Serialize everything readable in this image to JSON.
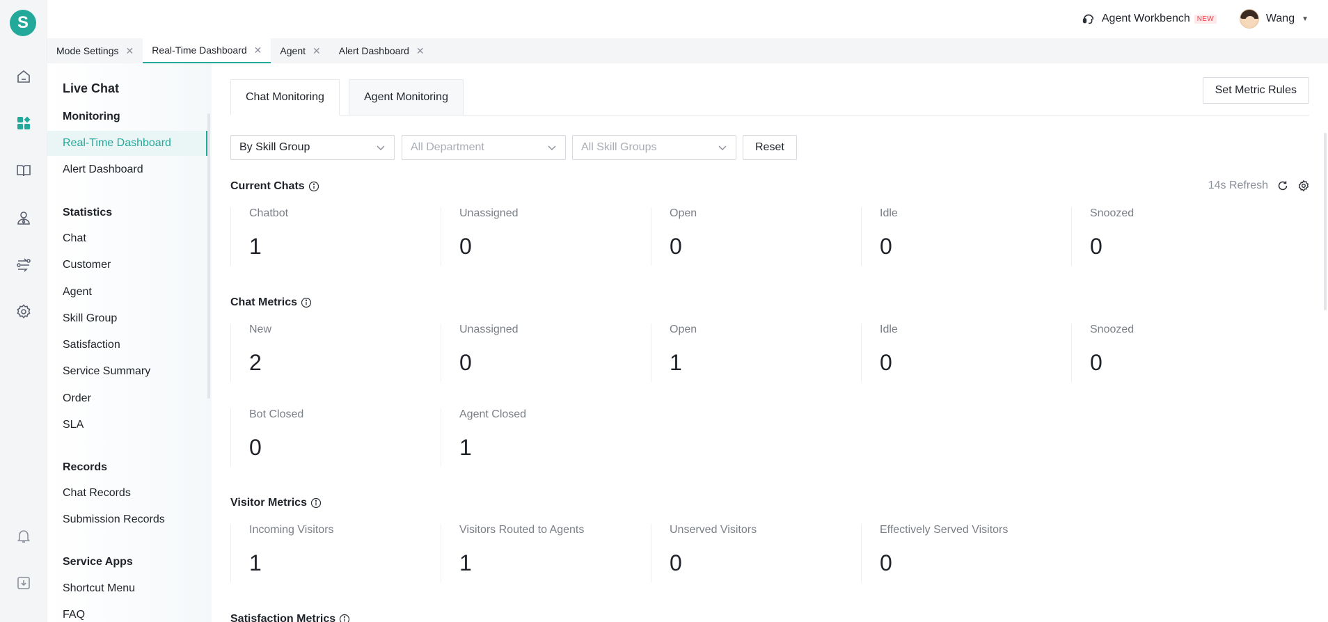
{
  "brand": {
    "logo_letter": "S",
    "accent": "#23a99a"
  },
  "rail": {
    "icons": [
      "home-icon",
      "dashboard-icon",
      "knowledge-book-icon",
      "customer-icon",
      "routing-icon",
      "settings-icon",
      "notification-bell-icon",
      "download-icon"
    ]
  },
  "topbar": {
    "workbench_label": "Agent Workbench",
    "workbench_badge": "NEW",
    "user_name": "Wang"
  },
  "tabs": [
    {
      "label": "Mode Settings",
      "active": false
    },
    {
      "label": "Real-Time Dashboard",
      "active": true
    },
    {
      "label": "Agent",
      "active": false
    },
    {
      "label": "Alert Dashboard",
      "active": false
    }
  ],
  "sidebar": {
    "title": "Live Chat",
    "groups": {
      "monitoring": {
        "heading": "Monitoring",
        "items": [
          "Real-Time Dashboard",
          "Alert Dashboard"
        ]
      },
      "statistics": {
        "heading": "Statistics",
        "items": [
          "Chat",
          "Customer",
          "Agent",
          "Skill Group",
          "Satisfaction",
          "Service Summary",
          "Order",
          "SLA"
        ]
      },
      "records": {
        "heading": "Records",
        "items": [
          "Chat Records",
          "Submission Records"
        ]
      },
      "service_apps": {
        "heading": "Service Apps",
        "items": [
          "Shortcut Menu",
          "FAQ"
        ]
      }
    },
    "active_item": "Real-Time Dashboard"
  },
  "main": {
    "tabs": [
      "Chat Monitoring",
      "Agent Monitoring"
    ],
    "active_tab": "Chat Monitoring",
    "set_metric_rules_label": "Set Metric Rules",
    "filters": {
      "group_by": "By Skill Group",
      "department_placeholder": "All Department",
      "skill_groups_placeholder": "All Skill Groups",
      "reset_label": "Reset"
    },
    "refresh_text": "14s Refresh",
    "current_chats": {
      "title": "Current Chats",
      "cards": [
        {
          "label": "Chatbot",
          "value": "1"
        },
        {
          "label": "Unassigned",
          "value": "0"
        },
        {
          "label": "Open",
          "value": "0"
        },
        {
          "label": "Idle",
          "value": "0"
        },
        {
          "label": "Snoozed",
          "value": "0"
        }
      ]
    },
    "chat_metrics": {
      "title": "Chat Metrics",
      "cards": [
        {
          "label": "New",
          "value": "2"
        },
        {
          "label": "Unassigned",
          "value": "0"
        },
        {
          "label": "Open",
          "value": "1"
        },
        {
          "label": "Idle",
          "value": "0"
        },
        {
          "label": "Snoozed",
          "value": "0"
        },
        {
          "label": "Bot Closed",
          "value": "0"
        },
        {
          "label": "Agent Closed",
          "value": "1"
        }
      ]
    },
    "visitor_metrics": {
      "title": "Visitor Metrics",
      "cards": [
        {
          "label": "Incoming Visitors",
          "value": "1"
        },
        {
          "label": "Visitors Routed to Agents",
          "value": "1"
        },
        {
          "label": "Unserved Visitors",
          "value": "0"
        },
        {
          "label": "Effectively Served Visitors",
          "value": "0"
        }
      ]
    },
    "satisfaction_metrics": {
      "title": "Satisfaction Metrics"
    }
  }
}
